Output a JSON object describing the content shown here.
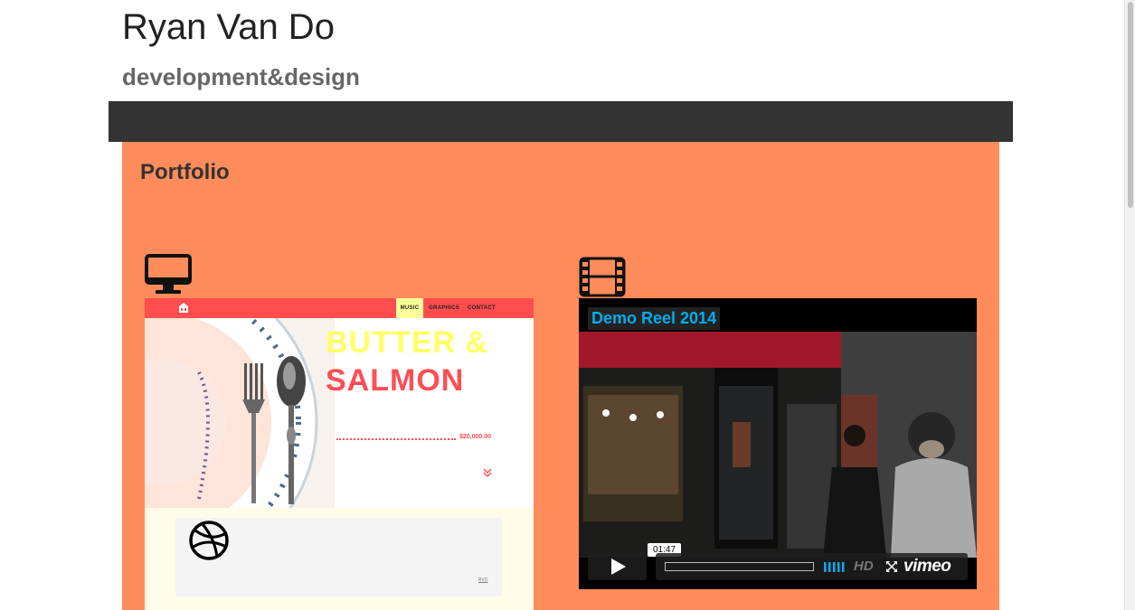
{
  "header": {
    "title": "Ryan Van Do",
    "subtitle": "development&design"
  },
  "main": {
    "section_title": "Portfolio"
  },
  "site_preview": {
    "nav": [
      "MUSIC",
      "GRAPHICS",
      "CONTACT"
    ],
    "hero_line1": "BUTTER &",
    "hero_line2": "SALMON",
    "price": "$20,000.00",
    "footer_mark": "RVD"
  },
  "video": {
    "title": "Demo Reel 2014",
    "duration": "01:47",
    "hd_label": "HD",
    "brand": "vimeo"
  },
  "colors": {
    "nav_bg": "#333333",
    "main_bg": "#ff8c5a",
    "preview_nav": "#ff4d4d",
    "vimeo_blue": "#00adef"
  },
  "icons": [
    "monitor-icon",
    "film-icon",
    "home-icon",
    "dribbble-icon",
    "play-icon",
    "volume-icon",
    "fullscreen-icon",
    "chevron-down-icon"
  ]
}
